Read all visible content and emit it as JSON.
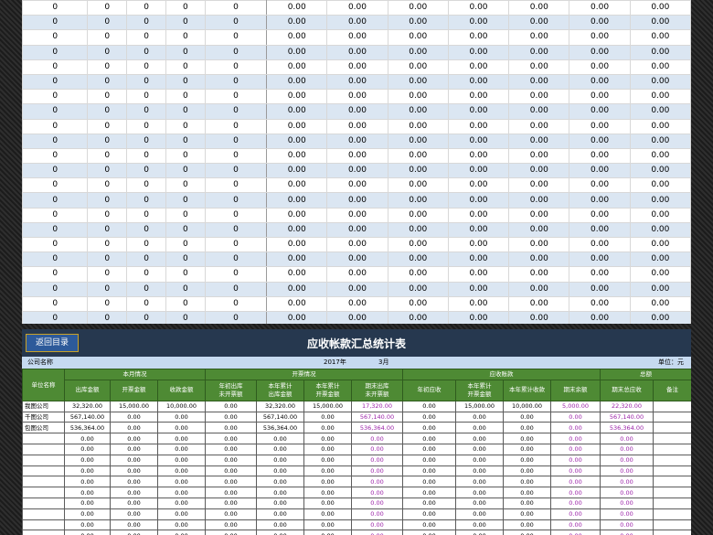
{
  "top_rows": [
    {
      "i": [
        "0",
        "0",
        "0",
        "0",
        "0"
      ],
      "d": [
        "0.00",
        "0.00",
        "0.00",
        "0.00",
        "0.00",
        "0.00",
        "0.00"
      ]
    }
  ],
  "top_row_count": 22,
  "bottom": {
    "back_button": "返回目录",
    "title": "应收帐款汇总统计表",
    "company_label": "公司名称",
    "year": "2017年",
    "month": "3月",
    "unit": "单位：元",
    "headers": {
      "unit_name": "单位名称",
      "month_status": "本月情况",
      "invoice_status": "开票情况",
      "receivable": "应收账款",
      "total": "总额",
      "sub": [
        "出库金额",
        "开票金额",
        "收款金额",
        "年初出库\n未开票额",
        "本年累计\n出库金额",
        "本年累计\n开票金额",
        "期末出库\n未开票额",
        "年初应收",
        "本年累计\n开票金额",
        "本年累计收款",
        "期末余额",
        "期末总应收",
        "备注"
      ]
    },
    "rows": [
      {
        "name": "我图公司",
        "v": [
          "32,320.00",
          "15,000.00",
          "10,000.00",
          "0.00",
          "32,320.00",
          "15,000.00",
          "17,320.00",
          "0.00",
          "15,000.00",
          "10,000.00",
          "5,000.00",
          "22,320.00",
          ""
        ]
      },
      {
        "name": "千图公司",
        "v": [
          "567,140.00",
          "0.00",
          "0.00",
          "0.00",
          "567,140.00",
          "0.00",
          "567,140.00",
          "0.00",
          "0.00",
          "0.00",
          "0.00",
          "567,140.00",
          ""
        ]
      },
      {
        "name": "包图公司",
        "v": [
          "536,364.00",
          "0.00",
          "0.00",
          "0.00",
          "536,364.00",
          "0.00",
          "536,364.00",
          "0.00",
          "0.00",
          "0.00",
          "0.00",
          "536,364.00",
          ""
        ]
      }
    ],
    "empty_row": [
      "0.00",
      "0.00",
      "0.00",
      "0.00",
      "0.00",
      "0.00",
      "0.00",
      "0.00",
      "0.00",
      "0.00",
      "0.00",
      "0.00",
      ""
    ],
    "empty_row_count": 11
  },
  "colors": {
    "header_green": "#4e8a34",
    "title_blue": "#26384f",
    "info_blue": "#c6daf0",
    "purple": "#9b22a8"
  }
}
